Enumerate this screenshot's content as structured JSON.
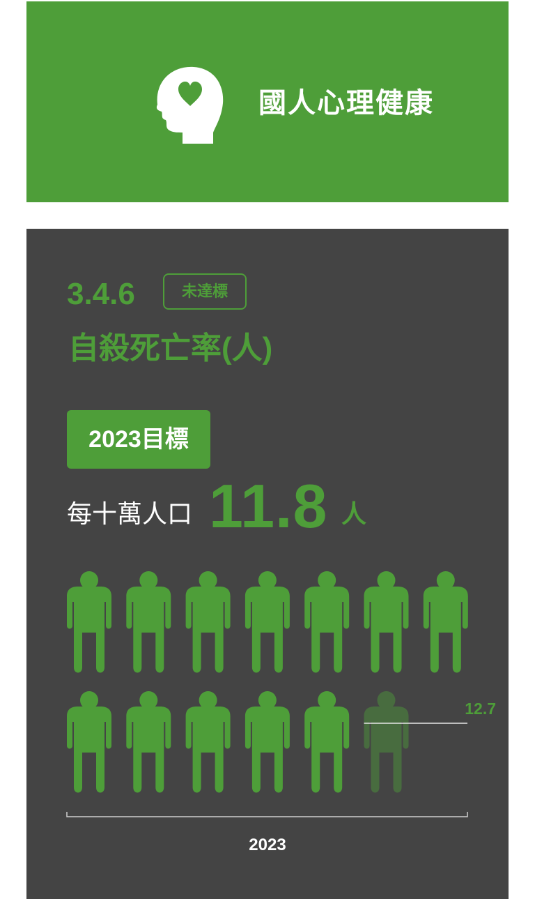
{
  "header": {
    "title": "國人心理健康",
    "icon": "head-heart-icon"
  },
  "indicator": {
    "code": "3.4.6",
    "status": "未達標",
    "name": "自殺死亡率(人)"
  },
  "target": {
    "badge": "2023目標",
    "unit_prefix": "每十萬人口",
    "value": "11.8",
    "unit_suffix": "人"
  },
  "pictogram": {
    "icon": "person-icon",
    "icons_per_row": 7,
    "unit_per_icon": 1,
    "icon_count": 13,
    "highlighted_count": 12
  },
  "actual": {
    "value": "12.7"
  },
  "axis": {
    "year": "2023"
  },
  "colors": {
    "accent": "#4e9e39",
    "panel": "#444444",
    "dimmed_icon": "#4e9e39 @ 45% opacity"
  }
}
